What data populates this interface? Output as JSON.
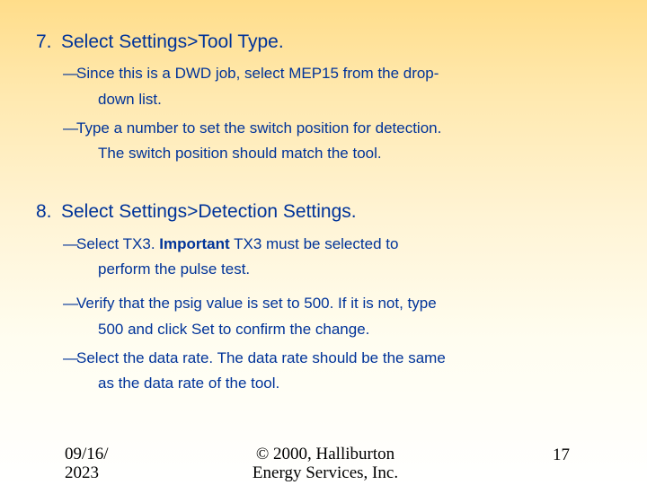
{
  "steps": [
    {
      "num": "7.",
      "title": "Select Settings>Tool Type.",
      "items": [
        {
          "line1": "Since this is a DWD job, select MEP15 from the drop-",
          "line2": "down list."
        },
        {
          "line1": "Type a number to set the switch position for detection.",
          "line2": "The switch position should match the tool."
        }
      ]
    },
    {
      "num": "8.",
      "title": "Select Settings>Detection Settings.",
      "items": [
        {
          "line1_pre": "Select TX3. ",
          "line1_bold": "Important",
          "line1_post": "  TX3 must be selected to",
          "line2": "perform the pulse test."
        },
        {
          "line1": "Verify that the psig value is set to 500. If it is not, type",
          "line2": "500 and click Set to confirm the change."
        },
        {
          "line1": "Select the data rate. The data rate should be the same",
          "line2": "as the data rate of the tool."
        }
      ]
    }
  ],
  "footer": {
    "date_line1": "09/16/",
    "date_line2": "2023",
    "copy_line1": "© 2000, Halliburton",
    "copy_line2": "Energy Services, Inc.",
    "page": "17"
  },
  "dash": "—"
}
